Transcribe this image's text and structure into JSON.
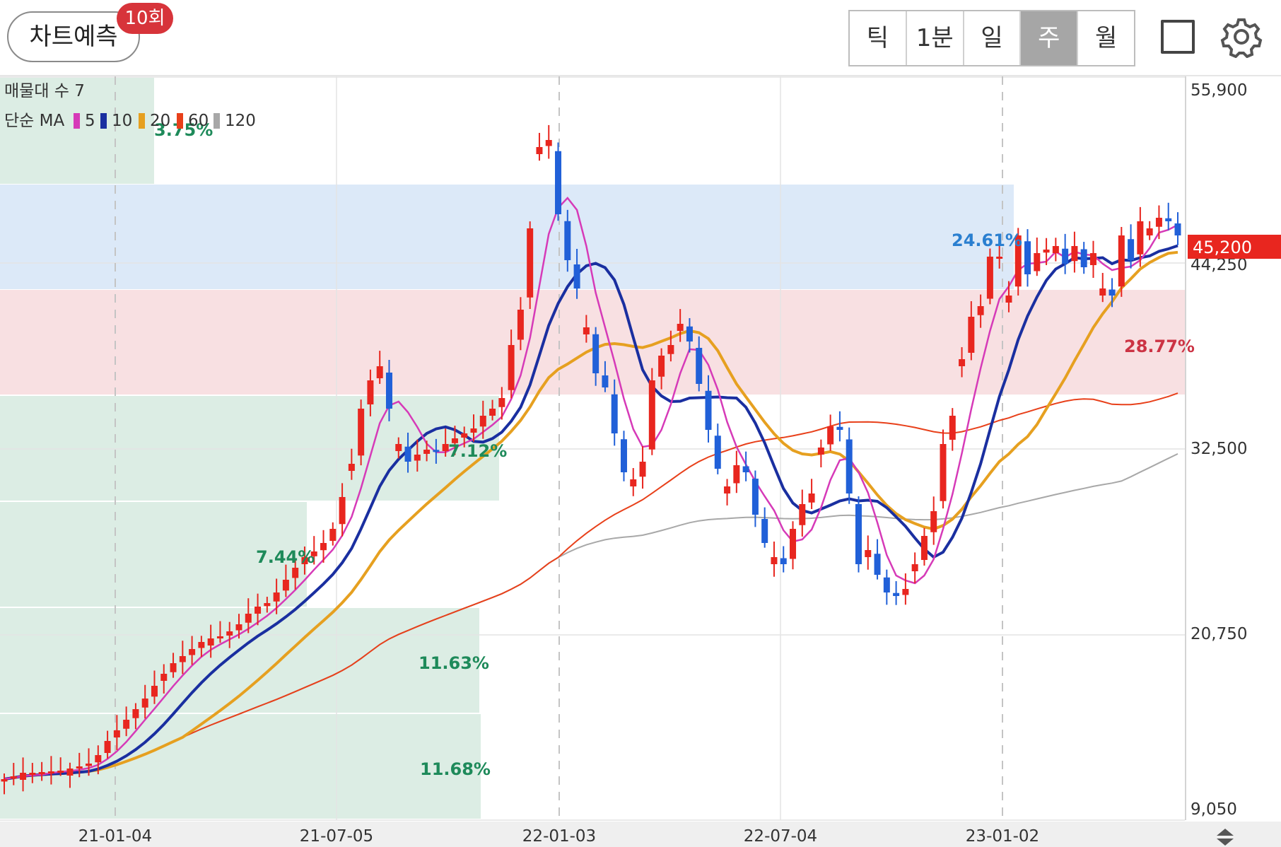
{
  "header": {
    "predict_label": "차트예측",
    "predict_count": "10회",
    "tabs": [
      {
        "label": "틱",
        "active": false
      },
      {
        "label": "1분",
        "active": false
      },
      {
        "label": "일",
        "active": false
      },
      {
        "label": "주",
        "active": true
      },
      {
        "label": "월",
        "active": false
      }
    ]
  },
  "colors": {
    "up": "#e8261f",
    "down": "#2160d8",
    "ma5": "#d63ab8",
    "ma10": "#1a2fa0",
    "ma20": "#e6a020",
    "ma60": "#e8401a",
    "ma120": "#a8a8a8",
    "volume_profile": "#dcede4",
    "resistance_zone": "#dce9f8",
    "support_zone": "#f8e0e2",
    "price_badge": "#e8261f"
  },
  "legend": {
    "volume_profile_label": "매물대 수 7",
    "ma_label": "단순 MA",
    "ma_periods": [
      "5",
      "10",
      "20",
      "60",
      "120"
    ]
  },
  "chart_data": {
    "type": "candlestick",
    "interval": "weekly",
    "y_axis_ticks": [
      "55,900",
      "44,250",
      "32,500",
      "20,750",
      "9,050"
    ],
    "x_axis_ticks": [
      "21-01-04",
      "21-07-05",
      "22-01-03",
      "22-07-04",
      "23-01-02"
    ],
    "current_price": "45,200",
    "volume_profile_labels": [
      "3.75%",
      "24.61%",
      "28.77%",
      "7.12%",
      "7.44%",
      "11.63%",
      "11.68%"
    ]
  }
}
